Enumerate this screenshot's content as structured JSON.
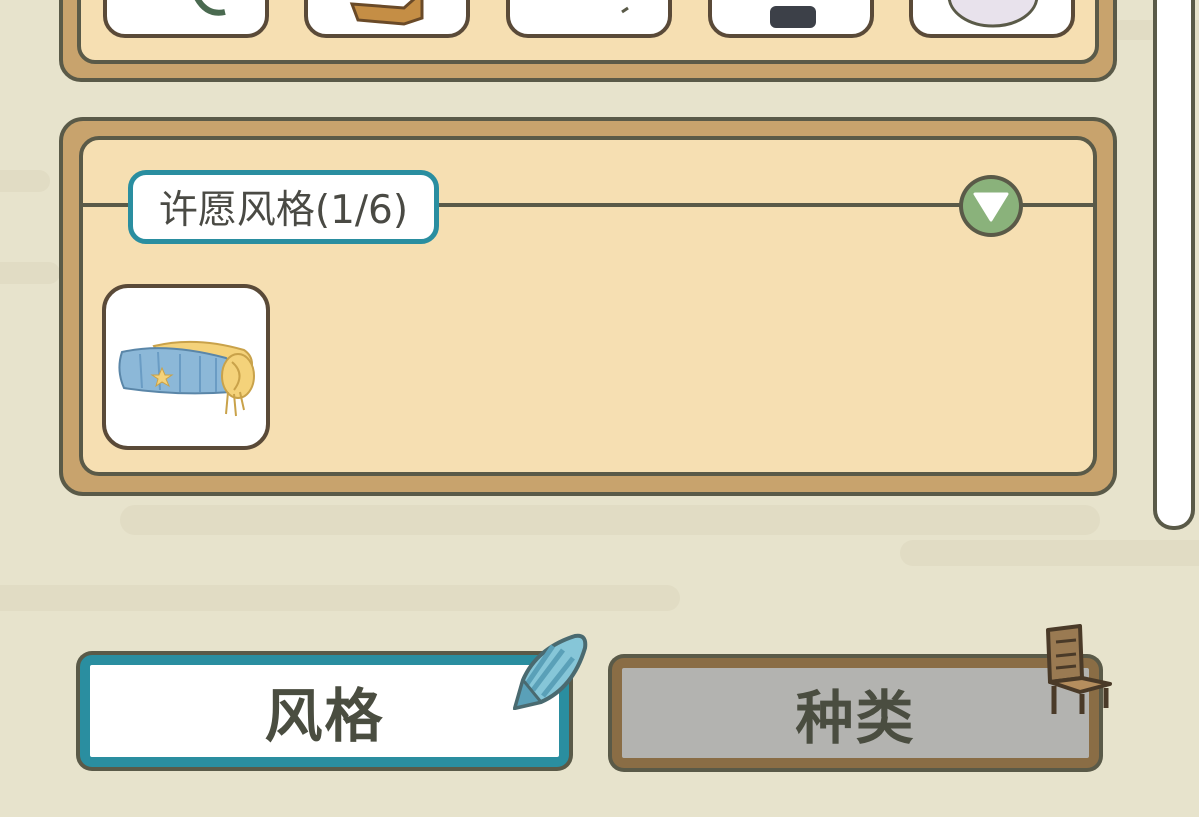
{
  "wish_section": {
    "title": "许愿风格(1/6)",
    "item_count_shown": 1
  },
  "tabs": {
    "style_label": "风格",
    "category_label": "种类",
    "active": "style"
  },
  "colors": {
    "background": "#e7e3cc",
    "panel_frame": "#c8a36d",
    "panel_fill": "#f6dfb2",
    "outline": "#5a5a48",
    "accent_teal": "#2a8ea0",
    "dropdown_green": "#8ab27b",
    "inactive_gray": "#b3b3b0"
  },
  "icons": {
    "dropdown": "triangle-down-icon",
    "item": "blanket-roll-icon",
    "style_tab": "seashell-icon",
    "category_tab": "chair-icon"
  }
}
